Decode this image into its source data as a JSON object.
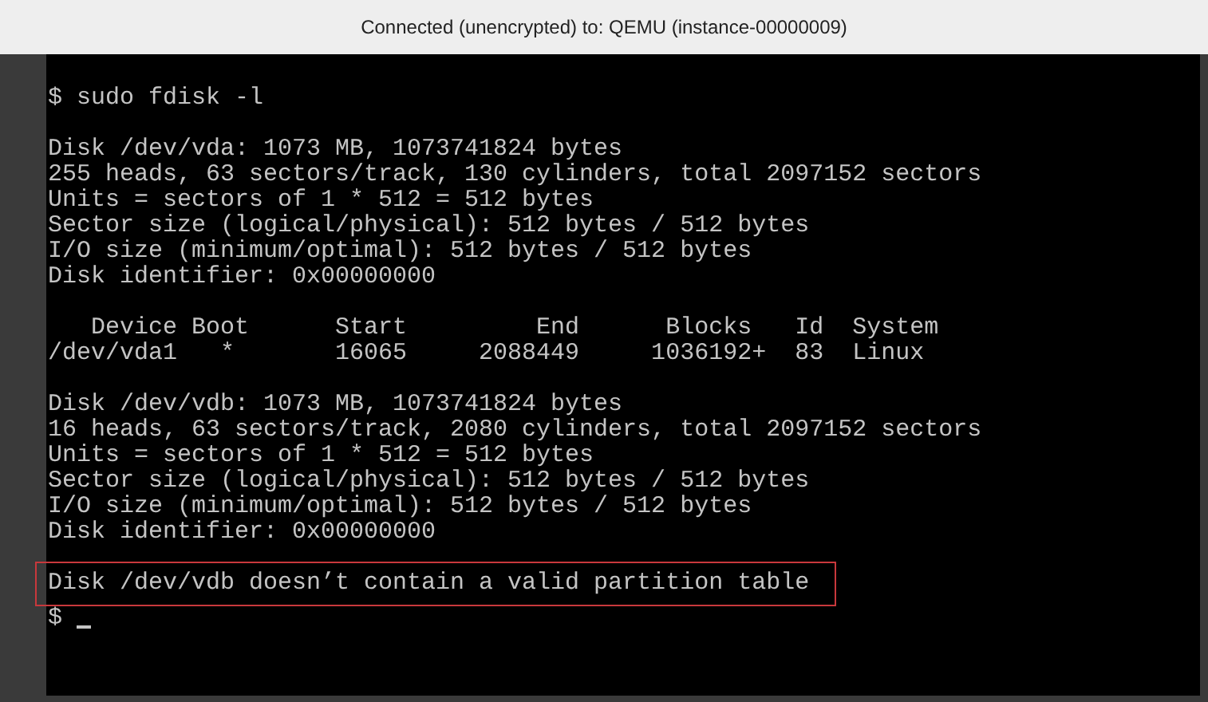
{
  "window": {
    "title": "Connected (unencrypted) to: QEMU (instance-00000009)"
  },
  "terminal": {
    "blocks": [
      {
        "highlighted": false,
        "lines": [
          "$ sudo fdisk -l"
        ]
      },
      {
        "highlighted": false,
        "lines": [
          "Disk /dev/vda: 1073 MB, 1073741824 bytes",
          "255 heads, 63 sectors/track, 130 cylinders, total 2097152 sectors",
          "Units = sectors of 1 * 512 = 512 bytes",
          "Sector size (logical/physical): 512 bytes / 512 bytes",
          "I/O size (minimum/optimal): 512 bytes / 512 bytes",
          "Disk identifier: 0x00000000"
        ]
      },
      {
        "highlighted": false,
        "lines": [
          "   Device Boot      Start         End      Blocks   Id  System",
          "/dev/vda1   *       16065     2088449     1036192+  83  Linux"
        ]
      },
      {
        "highlighted": false,
        "lines": [
          "Disk /dev/vdb: 1073 MB, 1073741824 bytes",
          "16 heads, 63 sectors/track, 2080 cylinders, total 2097152 sectors",
          "Units = sectors of 1 * 512 = 512 bytes",
          "Sector size (logical/physical): 512 bytes / 512 bytes",
          "I/O size (minimum/optimal): 512 bytes / 512 bytes",
          "Disk identifier: 0x00000000"
        ]
      },
      {
        "highlighted": true,
        "lines": [
          "Disk /dev/vdb doesn’t contain a valid partition table"
        ]
      }
    ],
    "prompt": "$"
  }
}
